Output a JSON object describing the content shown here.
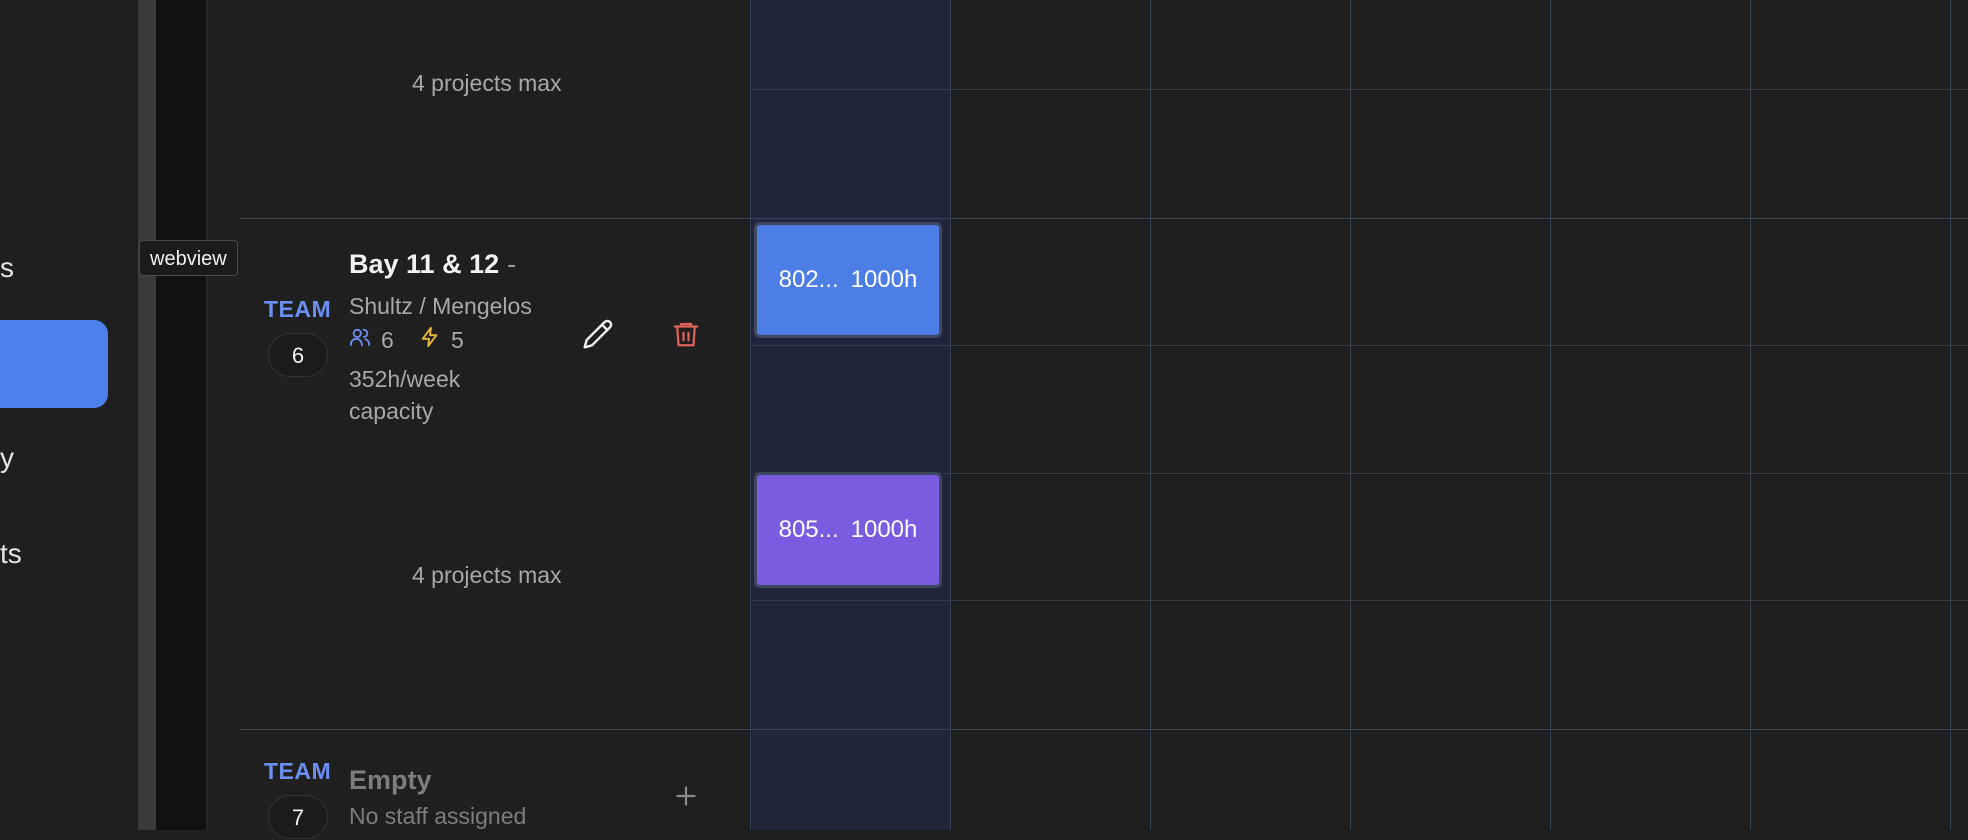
{
  "sidebar": {
    "items": [
      {
        "label": "s"
      },
      {
        "label": "y"
      },
      {
        "label": "ts"
      }
    ]
  },
  "tooltip": "webview",
  "rows": [
    {
      "max_label": "4 projects max"
    },
    {
      "team_label": "TEAM",
      "team_number": "6",
      "title": "Bay 11 & 12",
      "title_suffix": "-",
      "subtitle": "Shultz / Mengelos",
      "staff_count": "6",
      "power_count": "5",
      "capacity_line1": "352h/week",
      "capacity_line2": "capacity",
      "max_label": "4 projects max",
      "projects": [
        {
          "code": "802...",
          "hours": "1000h",
          "color": "#4d7ee6"
        },
        {
          "code": "805...",
          "hours": "1000h",
          "color": "#7a5ce0"
        }
      ]
    },
    {
      "team_label": "TEAM",
      "team_number": "7",
      "title": "Empty",
      "subtitle": "No staff assigned"
    }
  ],
  "colors": {
    "accent": "#4c80ec",
    "team_label": "#6b8ff0",
    "delete": "#e0605a",
    "power": "#e8b83a"
  },
  "icons": {
    "staff": "users-icon",
    "power": "lightning-icon",
    "edit": "pencil-icon",
    "delete": "trash-icon",
    "add": "plus-icon"
  }
}
